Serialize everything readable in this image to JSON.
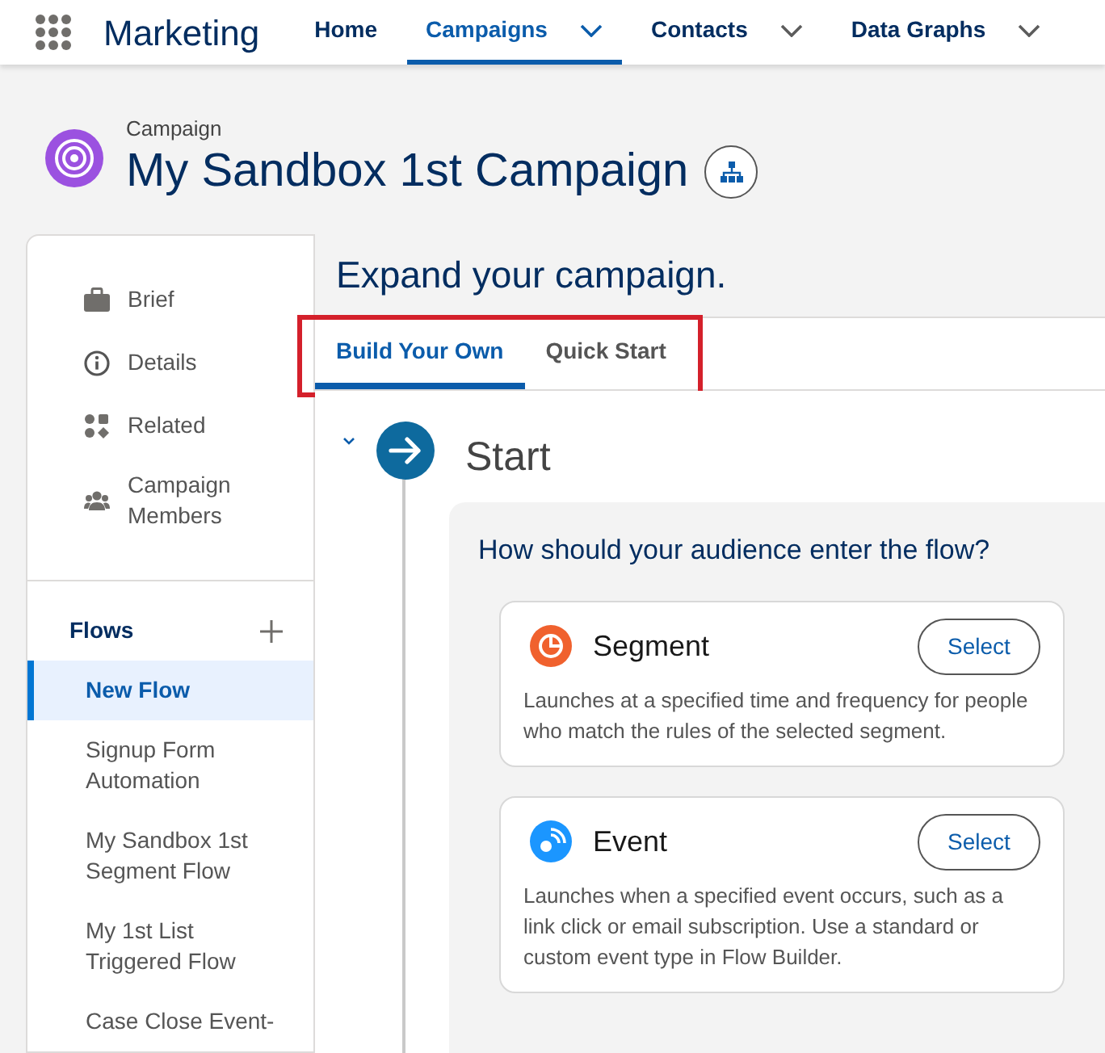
{
  "app": {
    "name": "Marketing"
  },
  "nav": [
    {
      "label": "Home",
      "selected": false,
      "dropdown": false
    },
    {
      "label": "Campaigns",
      "selected": true,
      "dropdown": true
    },
    {
      "label": "Contacts",
      "selected": false,
      "dropdown": true
    },
    {
      "label": "Data Graphs",
      "selected": false,
      "dropdown": true
    }
  ],
  "record": {
    "type": "Campaign",
    "title": "My Sandbox 1st Campaign"
  },
  "sidebar": {
    "items": [
      {
        "label": "Brief",
        "kind": "briefcase"
      },
      {
        "label": "Details",
        "kind": "info"
      },
      {
        "label": "Related",
        "kind": "related"
      },
      {
        "label": "Campaign Members",
        "kind": "members"
      }
    ],
    "flows": {
      "title": "Flows",
      "items": [
        {
          "label": "New Flow",
          "selected": true
        },
        {
          "label": "Signup Form Automation",
          "selected": false
        },
        {
          "label": "My Sandbox 1st Segment Flow",
          "selected": false
        },
        {
          "label": "My 1st List Triggered Flow",
          "selected": false
        },
        {
          "label": "Case Close Event-",
          "selected": false
        }
      ]
    }
  },
  "main": {
    "heading": "Expand your campaign.",
    "tabs": [
      {
        "label": "Build Your Own",
        "selected": true
      },
      {
        "label": "Quick Start",
        "selected": false
      }
    ],
    "step": {
      "title": "Start",
      "expanded": true,
      "question": "How should your audience enter the flow?",
      "options": [
        {
          "kind": "segment",
          "title": "Segment",
          "button": "Select",
          "description": "Launches at a specified time and frequency for people who match the rules of the selected segment."
        },
        {
          "kind": "event",
          "title": "Event",
          "button": "Select",
          "description": "Launches when a specified event occurs, such as a link click or email subscription. Use a standard or custom event type in Flow Builder."
        }
      ]
    }
  }
}
